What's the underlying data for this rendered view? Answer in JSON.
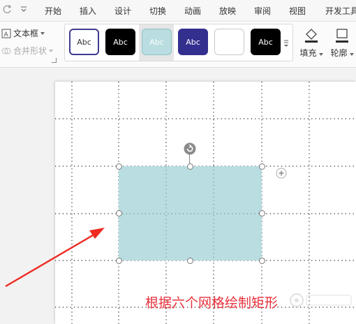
{
  "menu": {
    "items": [
      "开始",
      "插入",
      "设计",
      "切换",
      "动画",
      "放映",
      "审阅",
      "视图",
      "开发工具"
    ]
  },
  "ribbon": {
    "textbox_label": "文本框",
    "merge_label": "合并形状",
    "styles": [
      {
        "label": "Abc",
        "bg": "#ffffff",
        "fg": "#333333",
        "border": "#3f3b8f"
      },
      {
        "label": "Abc",
        "bg": "#000000",
        "fg": "#ffffff",
        "border": "#000000"
      },
      {
        "label": "Abc",
        "bg": "#b9dde0",
        "fg": "#ffffff",
        "border": "#8fc3c7"
      },
      {
        "label": "Abc",
        "bg": "#332f8f",
        "fg": "#ffffff",
        "border": "#332f8f"
      },
      {
        "label": "",
        "bg": "#ffffff",
        "fg": "#333333",
        "border": "#c9c9c9"
      },
      {
        "label": "Abc",
        "bg": "#000000",
        "fg": "#ffffff",
        "border": "#000000"
      }
    ],
    "fill_label": "填充",
    "outline_label": "轮廓"
  },
  "canvas": {
    "caption": "根据六个网格绘制矩形",
    "shape_fill": "#b9dde0",
    "caption_color": "#e8323c"
  }
}
